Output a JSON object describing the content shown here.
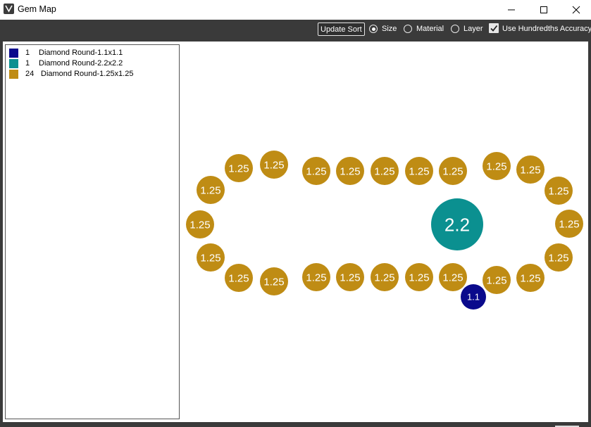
{
  "window": {
    "title": "Gem Map"
  },
  "toolbar": {
    "update_sort_label": "Update Sort",
    "sort_options": [
      {
        "label": "Size",
        "selected": true
      },
      {
        "label": "Material",
        "selected": false
      },
      {
        "label": "Layer",
        "selected": false
      }
    ],
    "accuracy_label": "Use Hundredths Accuracy",
    "accuracy_checked": true
  },
  "legend": [
    {
      "count": "1",
      "name": "Diamond Round-1.1x1.1",
      "color": "#0a0a8c"
    },
    {
      "count": "1",
      "name": "Diamond Round-2.2x2.2",
      "color": "#0b9090"
    },
    {
      "count": "24",
      "name": "Diamond Round-1.25x1.25",
      "color": "#bf8c14"
    }
  ],
  "colors": {
    "gem_125": "#bf8c14",
    "gem_22": "#0b9090",
    "gem_11": "#0a0a8c",
    "chrome_dark": "#3a3a3a"
  },
  "icons": {
    "app": "app-logo-icon",
    "minimize": "minimize-icon",
    "maximize": "maximize-icon",
    "close": "close-icon"
  },
  "gems": [
    {
      "label": "1.25",
      "type": "gem_125"
    },
    {
      "label": "1.25",
      "type": "gem_125"
    },
    {
      "label": "1.25",
      "type": "gem_125"
    },
    {
      "label": "1.25",
      "type": "gem_125"
    },
    {
      "label": "1.25",
      "type": "gem_125"
    },
    {
      "label": "1.25",
      "type": "gem_125"
    },
    {
      "label": "1.25",
      "type": "gem_125"
    },
    {
      "label": "1.25",
      "type": "gem_125"
    },
    {
      "label": "1.25",
      "type": "gem_125"
    },
    {
      "label": "1.25",
      "type": "gem_125"
    },
    {
      "label": "1.25",
      "type": "gem_125"
    },
    {
      "label": "1.25",
      "type": "gem_125"
    },
    {
      "label": "1.25",
      "type": "gem_125"
    },
    {
      "label": "1.25",
      "type": "gem_125"
    },
    {
      "label": "1.25",
      "type": "gem_125"
    },
    {
      "label": "1.25",
      "type": "gem_125"
    },
    {
      "label": "1.25",
      "type": "gem_125"
    },
    {
      "label": "1.25",
      "type": "gem_125"
    },
    {
      "label": "1.25",
      "type": "gem_125"
    },
    {
      "label": "1.25",
      "type": "gem_125"
    },
    {
      "label": "1.25",
      "type": "gem_125"
    },
    {
      "label": "1.25",
      "type": "gem_125"
    },
    {
      "label": "1.25",
      "type": "gem_125"
    },
    {
      "label": "1.25",
      "type": "gem_125"
    },
    {
      "label": "2.2",
      "type": "gem_22"
    },
    {
      "label": "1.1",
      "type": "gem_11"
    }
  ]
}
